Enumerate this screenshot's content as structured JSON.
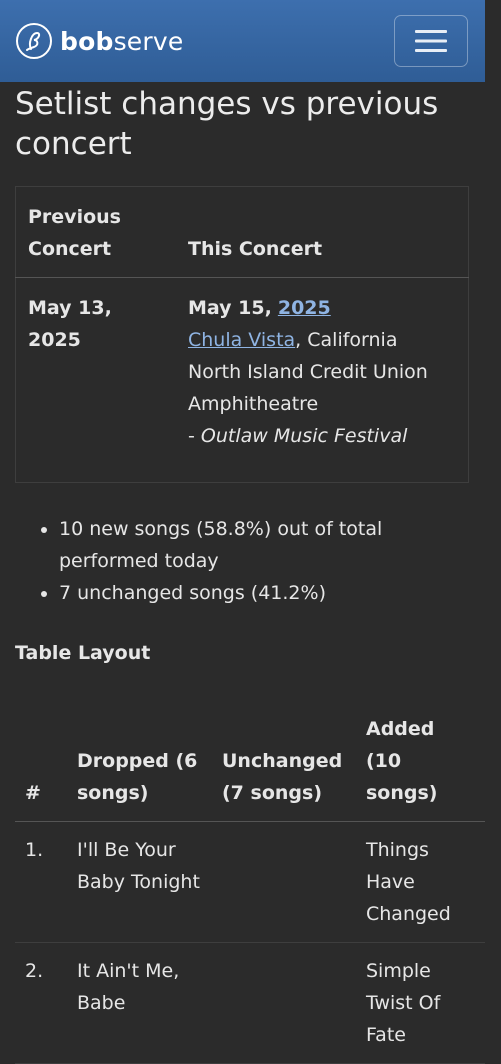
{
  "nav": {
    "brand_bold": "bob",
    "brand_rest": "serve"
  },
  "page": {
    "title": "Setlist changes vs previous concert"
  },
  "comparison": {
    "headers": {
      "previous": "Previous Concert",
      "this": "This Concert"
    },
    "previous_date": "May 13, 2025",
    "this_date_prefix": "May 15,",
    "this_year_link": "2025",
    "city_link": "Chula Vista",
    "state": ", California",
    "venue": "North Island Credit Union Amphitheatre",
    "festival_prefix": "- ",
    "festival": "Outlaw Music Festival"
  },
  "summary": [
    "10 new songs (58.8%) out of total performed today",
    "7 unchanged songs (41.2%)"
  ],
  "table_layout": {
    "heading": "Table Layout",
    "columns": [
      "#",
      "Dropped (6 songs)",
      "Unchanged (7 songs)",
      "Added (10 songs)"
    ],
    "rows": [
      {
        "num": "1.",
        "dropped": "I'll Be Your Baby Tonight",
        "unchanged": "",
        "added": "Things Have Changed"
      },
      {
        "num": "2.",
        "dropped": "It Ain't Me, Babe",
        "unchanged": "",
        "added": "Simple Twist Of Fate"
      }
    ]
  }
}
